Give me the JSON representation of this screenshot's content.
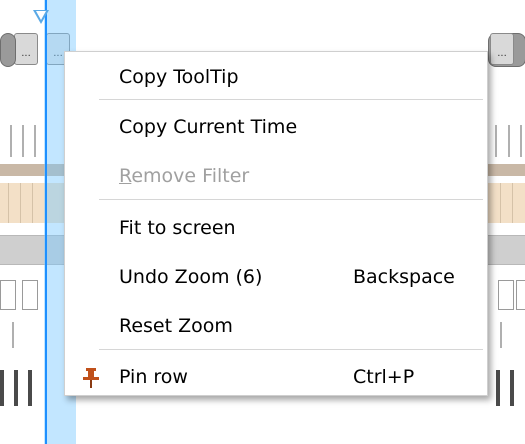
{
  "context_menu": {
    "items": [
      {
        "label": "Copy ToolTip",
        "shortcut": "",
        "enabled": true
      },
      {
        "label": "Copy Current Time",
        "shortcut": "",
        "enabled": true
      },
      {
        "label_mnemonic": "R",
        "label_rest": "emove Filter",
        "shortcut": "",
        "enabled": false
      },
      {
        "label": "Fit to screen",
        "shortcut": "",
        "enabled": true
      },
      {
        "label": "Undo Zoom (6)",
        "shortcut": "Backspace",
        "enabled": true
      },
      {
        "label": "Reset Zoom",
        "shortcut": "",
        "enabled": true
      },
      {
        "label": "Pin row",
        "shortcut": "Ctrl+P",
        "enabled": true,
        "icon": "pin-icon"
      }
    ]
  },
  "timeline": {
    "segment_dots_label": "...",
    "cursor_color": "#1e90ff",
    "pin_color": "#c0501a"
  }
}
